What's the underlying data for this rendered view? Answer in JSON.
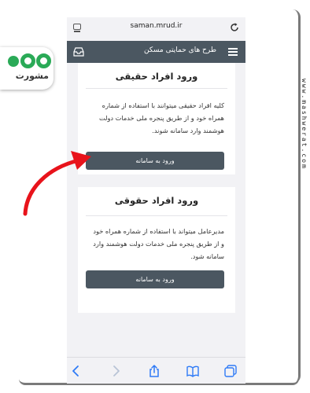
{
  "browser": {
    "url": "saman.mrud.ir"
  },
  "navbar": {
    "title": "طرح های حمایتی مسکن"
  },
  "cards": [
    {
      "title": "ورود افراد حقیقی",
      "description": "کلیه افراد حقیقی میتوانند با استفاده از شماره همراه خود و از طریق پنجره ملی خدمات دولت هوشمند وارد سامانه شوند.",
      "button_label": "ورود به سامانه"
    },
    {
      "title": "ورود افراد حقوقی",
      "description": "مدیرعامل میتواند با استفاده از شماره همراه خود و از طریق پنجره ملی خدمات دولت هوشمند وارد سامانه شود.",
      "button_label": "ورود به سامانه"
    }
  ],
  "watermark": {
    "logo_text": "مشورت",
    "site_text": "www.mashwerat.com"
  },
  "colors": {
    "navbar_bg": "#4b5761",
    "button_bg": "#4b5761",
    "accent_toolbar": "#2f7bf6",
    "logo_green": "#2aaa57",
    "arrow_red": "#e8131b"
  },
  "toolbar": {
    "icons": [
      "back-icon",
      "forward-icon",
      "share-icon",
      "bookmarks-icon",
      "tabs-icon"
    ]
  }
}
